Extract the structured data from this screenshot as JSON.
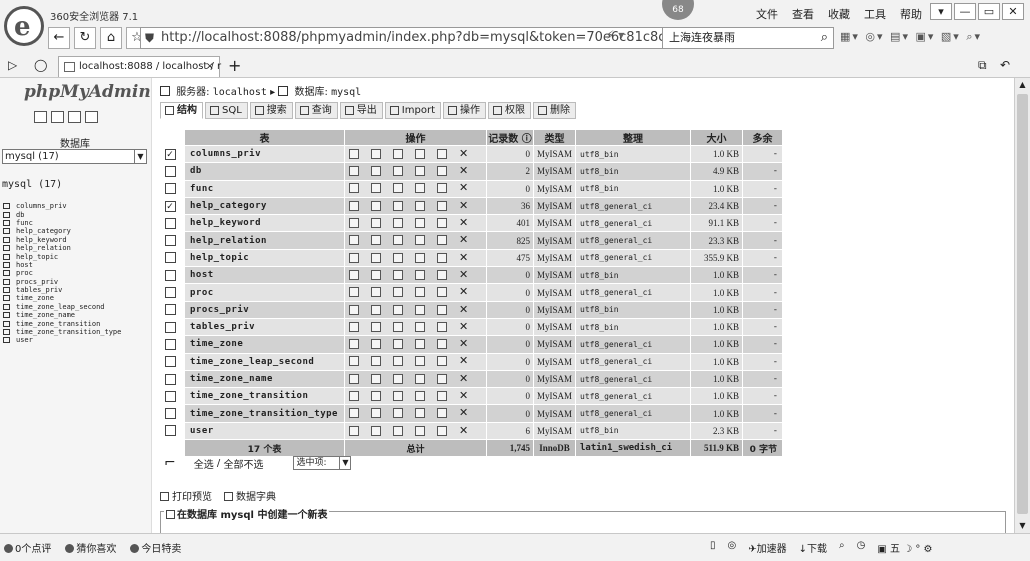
{
  "browser": {
    "name": "360安全浏览器 7.1",
    "logo_glyph": "e",
    "badge": "68",
    "menu": [
      "文件",
      "查看",
      "收藏",
      "工具",
      "帮助"
    ],
    "window_buttons": [
      "▾",
      "—",
      "▭",
      "✕"
    ],
    "url": "http://localhost:8088/phpmyadmin/index.php?db=mysql&token=70e6c81c8c31",
    "search_text": "上海连夜暴雨",
    "tab_title": "localhost:8088 / localhost / r",
    "new_tab": "+"
  },
  "sidebar": {
    "logo": "phpMyAdmin",
    "db_label": "数据库",
    "db_select": "mysql (17)",
    "db_heading": "mysql (17)",
    "tables": [
      "columns_priv",
      "db",
      "func",
      "help_category",
      "help_keyword",
      "help_relation",
      "help_topic",
      "host",
      "proc",
      "procs_priv",
      "tables_priv",
      "time_zone",
      "time_zone_leap_second",
      "time_zone_name",
      "time_zone_transition",
      "time_zone_transition_type",
      "user"
    ]
  },
  "main": {
    "breadcrumb": {
      "server_label": "服务器:",
      "server": "localhost",
      "db_label": "数据库:",
      "db": "mysql"
    },
    "tabs": [
      "结构",
      "SQL",
      "搜索",
      "查询",
      "导出",
      "Import",
      "操作",
      "权限",
      "删除"
    ],
    "table_headers": [
      "表",
      "操作",
      "记录数",
      "类型",
      "整理",
      "大小",
      "多余"
    ],
    "rows": [
      {
        "name": "columns_priv",
        "records": "0",
        "type": "MyISAM",
        "collation": "utf8_bin",
        "size": "1.0 KB",
        "overhead": "-",
        "checked": true
      },
      {
        "name": "db",
        "records": "2",
        "type": "MyISAM",
        "collation": "utf8_bin",
        "size": "4.9 KB",
        "overhead": "-",
        "checked": false
      },
      {
        "name": "func",
        "records": "0",
        "type": "MyISAM",
        "collation": "utf8_bin",
        "size": "1.0 KB",
        "overhead": "-",
        "checked": false
      },
      {
        "name": "help_category",
        "records": "36",
        "type": "MyISAM",
        "collation": "utf8_general_ci",
        "size": "23.4 KB",
        "overhead": "-",
        "checked": true
      },
      {
        "name": "help_keyword",
        "records": "401",
        "type": "MyISAM",
        "collation": "utf8_general_ci",
        "size": "91.1 KB",
        "overhead": "-",
        "checked": false
      },
      {
        "name": "help_relation",
        "records": "825",
        "type": "MyISAM",
        "collation": "utf8_general_ci",
        "size": "23.3 KB",
        "overhead": "-",
        "checked": false
      },
      {
        "name": "help_topic",
        "records": "475",
        "type": "MyISAM",
        "collation": "utf8_general_ci",
        "size": "355.9 KB",
        "overhead": "-",
        "checked": false
      },
      {
        "name": "host",
        "records": "0",
        "type": "MyISAM",
        "collation": "utf8_bin",
        "size": "1.0 KB",
        "overhead": "-",
        "checked": false
      },
      {
        "name": "proc",
        "records": "0",
        "type": "MyISAM",
        "collation": "utf8_general_ci",
        "size": "1.0 KB",
        "overhead": "-",
        "checked": false
      },
      {
        "name": "procs_priv",
        "records": "0",
        "type": "MyISAM",
        "collation": "utf8_bin",
        "size": "1.0 KB",
        "overhead": "-",
        "checked": false
      },
      {
        "name": "tables_priv",
        "records": "0",
        "type": "MyISAM",
        "collation": "utf8_bin",
        "size": "1.0 KB",
        "overhead": "-",
        "checked": false
      },
      {
        "name": "time_zone",
        "records": "0",
        "type": "MyISAM",
        "collation": "utf8_general_ci",
        "size": "1.0 KB",
        "overhead": "-",
        "checked": false
      },
      {
        "name": "time_zone_leap_second",
        "records": "0",
        "type": "MyISAM",
        "collation": "utf8_general_ci",
        "size": "1.0 KB",
        "overhead": "-",
        "checked": false
      },
      {
        "name": "time_zone_name",
        "records": "0",
        "type": "MyISAM",
        "collation": "utf8_general_ci",
        "size": "1.0 KB",
        "overhead": "-",
        "checked": false
      },
      {
        "name": "time_zone_transition",
        "records": "0",
        "type": "MyISAM",
        "collation": "utf8_general_ci",
        "size": "1.0 KB",
        "overhead": "-",
        "checked": false
      },
      {
        "name": "time_zone_transition_type",
        "records": "0",
        "type": "MyISAM",
        "collation": "utf8_general_ci",
        "size": "1.0 KB",
        "overhead": "-",
        "checked": false
      },
      {
        "name": "user",
        "records": "6",
        "type": "MyISAM",
        "collation": "utf8_bin",
        "size": "2.3 KB",
        "overhead": "-",
        "checked": false
      }
    ],
    "footer": {
      "count": "17 个表",
      "total_label": "总计",
      "records": "1,745",
      "engine": "InnoDB",
      "collation": "latin1_swedish_ci",
      "size": "511.9 KB",
      "overhead": "0 字节"
    },
    "bulk": {
      "select_all": "全选",
      "separator": "/",
      "select_none": "全部不选",
      "with_selected": "选中项:"
    },
    "print_view": "打印预览",
    "data_dictionary": "数据字典",
    "create_table_legend": "在数据库 mysql 中创建一个新表"
  },
  "statusbar": {
    "left": [
      "0个点评",
      "猜你喜欢",
      "今日特卖"
    ],
    "right": [
      "加速器",
      "下载"
    ]
  }
}
